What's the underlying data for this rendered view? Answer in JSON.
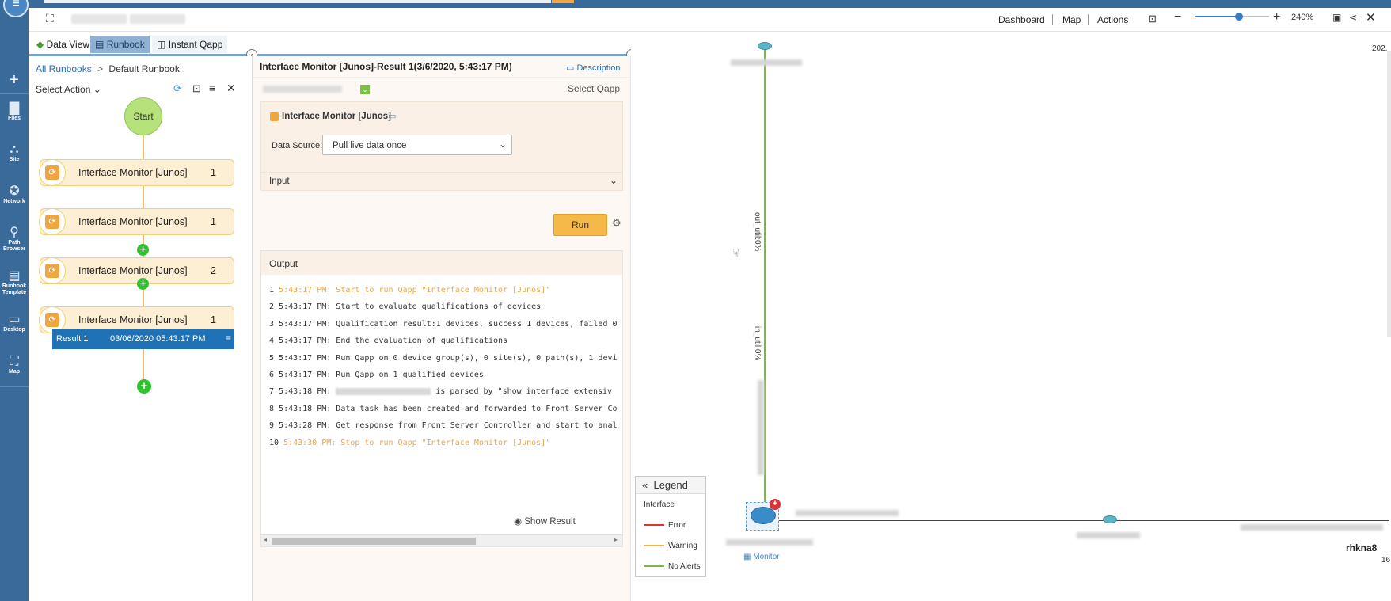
{
  "toolbar": {
    "dashboard": "Dashboard",
    "map": "Map",
    "actions": "Actions",
    "zoom": "240%",
    "zoom_fraction": 0.6
  },
  "tabs": {
    "data_view": "Data View",
    "runbook": "Runbook",
    "instant_qapp": "Instant Qapp"
  },
  "rail": {
    "files": "Files",
    "site": "Site",
    "network": "Network",
    "path_browser": "Path Browser",
    "runbook_template": "Runbook Template",
    "desktop": "Desktop",
    "map": "Map"
  },
  "runbook": {
    "all_runbooks": "All Runbooks",
    "sep": ">",
    "current": "Default Runbook",
    "select_action": "Select Action",
    "start": "Start",
    "nodes": [
      {
        "label": "Interface Monitor [Junos]",
        "count": "1"
      },
      {
        "label": "Interface Monitor [Junos]",
        "count": "1"
      },
      {
        "label": "Interface Monitor [Junos]",
        "count": "2"
      },
      {
        "label": "Interface Monitor [Junos]",
        "count": "1"
      }
    ],
    "result": {
      "label": "Result 1",
      "time": "03/06/2020 05:43:17 PM"
    }
  },
  "detail": {
    "title": "Interface Monitor [Junos]-Result 1(3/6/2020, 5:43:17 PM)",
    "description": "Description",
    "select_qapp": "Select Qapp",
    "qapp_name": "Interface Monitor [Junos]",
    "data_source_label": "Data Source:",
    "data_source_value": "Pull live data once",
    "input_label": "Input",
    "run": "Run",
    "output_label": "Output",
    "show_result": "Show Result",
    "lines": [
      {
        "n": "1",
        "t": "5:43:17 PM: Start to run Qapp \"Interface Monitor [Junos]\""
      },
      {
        "n": "2",
        "t": "5:43:17 PM: Start to evaluate qualifications of devices"
      },
      {
        "n": "3",
        "t": "5:43:17 PM: Qualification result:1 devices, success 1 devices, failed 0"
      },
      {
        "n": "4",
        "t": "5:43:17 PM: End the evaluation of qualifications"
      },
      {
        "n": "5",
        "t": "5:43:17 PM: Run Qapp on 0 device group(s), 0 site(s), 0 path(s), 1 devi"
      },
      {
        "n": "6",
        "t": "5:43:17 PM: Run Qapp on 1 qualified devices"
      },
      {
        "n": "7",
        "t": "5:43:18 PM:",
        "t2": "is parsed by \"show interface extensiv"
      },
      {
        "n": "8",
        "t": "5:43:18 PM: Data task has been created and forwarded to Front Server Co"
      },
      {
        "n": "9",
        "t": "5:43:28 PM: Get response from Front Server Controller and start to anal"
      },
      {
        "n": "10",
        "t": "5:43:30 PM: Stop to run Qapp \"Interface Monitor [Junos]\""
      }
    ]
  },
  "map": {
    "top_right": "202.",
    "out_util": "out_util:0%",
    "in_util": "in_util:0%",
    "monitor": "Monitor",
    "device_right": "rhkna8",
    "device_right_sub": "16",
    "legend": {
      "title": "Legend",
      "interface": "Interface",
      "error": "Error",
      "warning": "Warning",
      "no_alerts": "No Alerts",
      "colors": {
        "error": "#e0342f",
        "warning": "#f4b342",
        "no_alerts": "#7ab941"
      }
    }
  }
}
